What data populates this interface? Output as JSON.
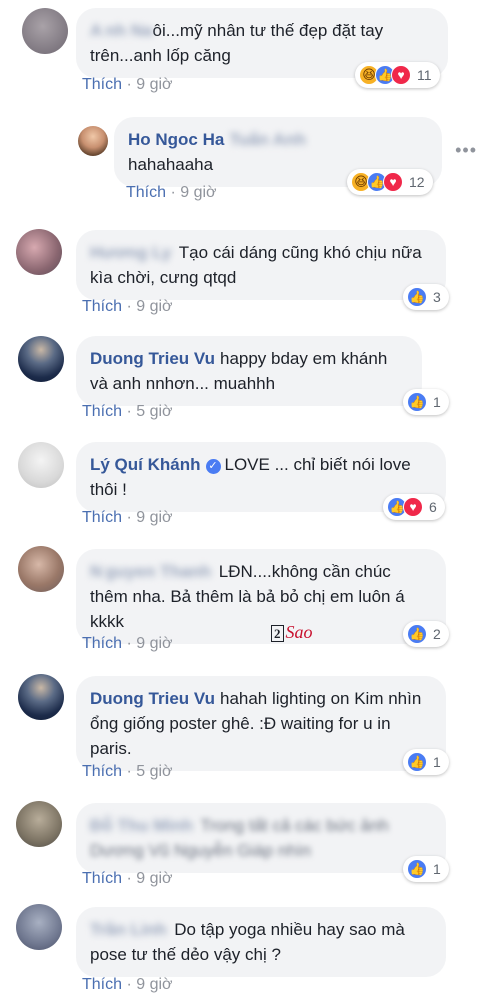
{
  "like_label": "Thích",
  "comments": [
    {
      "name": "A",
      "text": "ôi...mỹ nhân tư thế đẹp đặt tay trên...anh lốp căng",
      "time": "9 giờ",
      "reactions": [
        "haha",
        "like",
        "love"
      ],
      "count": "11"
    },
    {
      "name": "Ho Ngoc Ha",
      "text": "hahahaaha",
      "time": "9 giờ",
      "reactions": [
        "haha",
        "like",
        "love"
      ],
      "count": "12"
    },
    {
      "text": "Tạo cái dáng cũng khó chịu nữa kìa chời, cưng qtqd",
      "time": "9 giờ",
      "reactions": [
        "like"
      ],
      "count": "3"
    },
    {
      "name": "Duong Trieu Vu",
      "text": "happy bday em khánh và anh nnhơn... muahhh",
      "time": "5 giờ",
      "reactions": [
        "like"
      ],
      "count": "1"
    },
    {
      "name": "Lý Quí Khánh",
      "text": "LOVE ... chỉ biết nói love thôi !",
      "time": "9 giờ",
      "reactions": [
        "like",
        "love"
      ],
      "count": "6"
    },
    {
      "name": "N",
      "text": "LĐN....không cần chúc thêm nha. Bả thêm là bả bỏ chị em luôn á kkkk",
      "time": "9 giờ",
      "reactions": [
        "like"
      ],
      "count": "2"
    },
    {
      "name": "Duong Trieu Vu",
      "text": "hahah lighting on Kim nhìn ổng giống poster ghê. :Đ waiting for u in paris.",
      "time": "5 giờ",
      "reactions": [
        "like"
      ],
      "count": "1"
    },
    {
      "time": "9 giờ",
      "reactions": [
        "like"
      ],
      "count": "1"
    },
    {
      "text": "Do tập yoga nhiều hay sao mà pose tư thế dẻo vậy chị ?",
      "time": "9 giờ"
    }
  ],
  "watermark": {
    "number": "2",
    "text": "Sao"
  },
  "colors": {
    "name": "#365899",
    "bubble": "#f2f3f5",
    "like_reaction": "#4a7cf3",
    "love_reaction": "#f0284a",
    "haha_reaction": "#f7b125"
  }
}
